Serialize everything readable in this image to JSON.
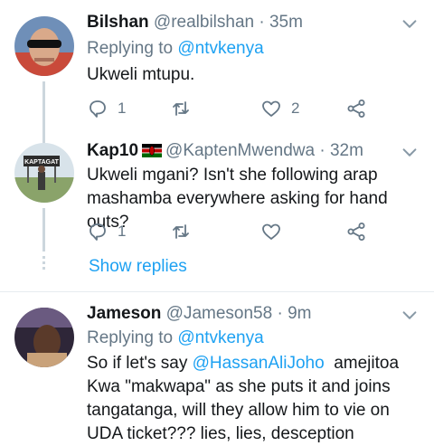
{
  "tweets": [
    {
      "name": "Bilshan",
      "handle": "@realbilshan",
      "time": "· 35m",
      "reply_prefix": "Replying to",
      "reply_to": "@ntvkenya",
      "text": "Ukweli mtupu.",
      "reply_count": "1",
      "retweet_count": "",
      "like_count": "2"
    },
    {
      "name": "Kap10",
      "handle": "@KaptenMwendwa",
      "time": "· 32m",
      "text": "Ukweli mgani? Isn't she following arap mashamba everywhere asking for hand outs?",
      "reply_count": "1",
      "retweet_count": "",
      "like_count": "",
      "avatar_sign": "KAPTAGAT"
    },
    {
      "name": "Jameson",
      "handle": "@Jameson58",
      "time": "· 9m",
      "reply_prefix": "Replying to",
      "reply_to": "@ntvkenya",
      "text_pre": "So if let's say ",
      "text_mention": "@HassanAliJoho",
      "text_post": "  amejitoa Kwa \"makwapa\" as she puts it and joins tangatanga, will they allow him to vie on UDA ticket??? lies, lies, desception"
    }
  ],
  "show_replies_label": "Show replies",
  "colors": {
    "accent": "#1da1f2",
    "muted": "#657786",
    "text": "#14171a",
    "thread": "#ccd6dd"
  },
  "icons": [
    "chevron-down-icon",
    "reply-icon",
    "retweet-icon",
    "like-icon",
    "share-icon",
    "kenya-flag-icon"
  ]
}
